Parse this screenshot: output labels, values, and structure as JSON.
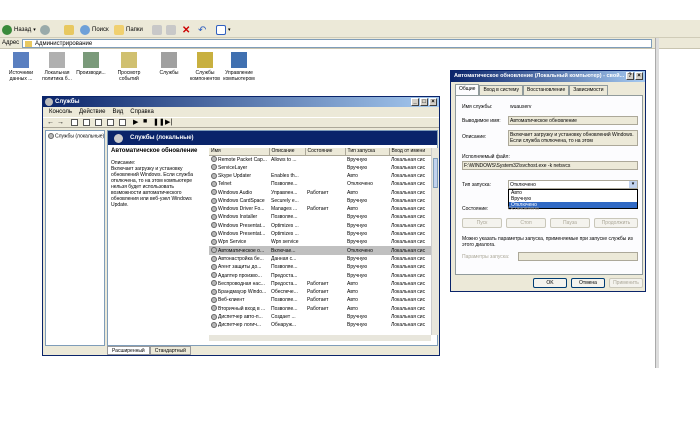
{
  "explorer": {
    "toolbar": {
      "back": "Назад",
      "search": "Поиск",
      "folders": "Папки"
    },
    "address": {
      "label": "Адрес",
      "value": "Администрирование"
    },
    "tools": [
      {
        "label": "Источники данных ...",
        "icon": "database-icon"
      },
      {
        "label": "Локальная политика б...",
        "icon": "security-policy-icon"
      },
      {
        "label": "Производи...",
        "icon": "performance-icon"
      },
      {
        "label": "Просмотр событий",
        "icon": "event-viewer-icon"
      },
      {
        "label": "Службы",
        "icon": "services-icon"
      },
      {
        "label": "Службы компонентов",
        "icon": "component-services-icon"
      },
      {
        "label": "Управление компьютером",
        "icon": "computer-management-icon"
      }
    ]
  },
  "services": {
    "title": "Службы",
    "menu": [
      "Консоль",
      "Действие",
      "Вид",
      "Справка"
    ],
    "tree_item": "Службы (локальные)",
    "pane_header": "Службы (локальные)",
    "desc_title": "Автоматическое обновление",
    "desc_label": "Описание:",
    "desc_text": "Включает загрузку и установку обновлений Windows. Если служба отключена, то на этом компьютере нельзя будет использовать возможности автоматического обновления или веб-узел Windows Update.",
    "columns": [
      "Имя",
      "Описание",
      "Состояние",
      "Тип запуска",
      "Вход от имени"
    ],
    "rows": [
      [
        "Remote Packet Cap...",
        "Allows to ...",
        "",
        "Вручную",
        "Локальная сис"
      ],
      [
        "ServiceLayer",
        "",
        "",
        "Вручную",
        "Локальная сис"
      ],
      [
        "Skype Updater",
        "Enables th...",
        "",
        "Авто",
        "Локальная сис"
      ],
      [
        "Telnet",
        "Позволяе...",
        "",
        "Отключено",
        "Локальная сис"
      ],
      [
        "Windows Audio",
        "Управлен...",
        "Работает",
        "Авто",
        "Локальная сис"
      ],
      [
        "Windows CardSpace",
        "Securely e...",
        "",
        "Вручную",
        "Локальная сис"
      ],
      [
        "Windows Driver Fo...",
        "Manages ...",
        "Работает",
        "Авто",
        "Локальная сис"
      ],
      [
        "Windows Installer",
        "Позволяе...",
        "",
        "Вручную",
        "Локальная сис"
      ],
      [
        "Windows Presentat...",
        "Optimizes ...",
        "",
        "Вручную",
        "Локальная сис"
      ],
      [
        "Windows Presentat...",
        "Optimizes ...",
        "",
        "Вручную",
        "Локальная сис"
      ],
      [
        "Wpn Service",
        "Wpn service",
        "",
        "Вручную",
        "Локальная сис"
      ],
      [
        "Автоматическое о...",
        "Включае...",
        "",
        "Отключено",
        "Локальная сис"
      ],
      [
        "Автонастройка бе...",
        "Данная с...",
        "",
        "Вручную",
        "Локальная сис"
      ],
      [
        "Агент защиты до...",
        "Позволяе...",
        "",
        "Вручную",
        "Локальная сис"
      ],
      [
        "Адаптер произво...",
        "Предоста...",
        "",
        "Вручную",
        "Локальная сис"
      ],
      [
        "Беспроводная нас...",
        "Предоста...",
        "Работает",
        "Авто",
        "Локальная сис"
      ],
      [
        "Брандмауэр Windo...",
        "Обеспече...",
        "Работает",
        "Авто",
        "Локальная сис"
      ],
      [
        "Веб-клиент",
        "Позволяе...",
        "Работает",
        "Авто",
        "Локальная сис"
      ],
      [
        "Вторичный вход в ...",
        "Позволяе...",
        "Работает",
        "Авто",
        "Локальная сис"
      ],
      [
        "Диспетчер авто-п...",
        "Создает ...",
        "",
        "Вручную",
        "Локальная сис"
      ],
      [
        "Диспетчер логич...",
        "Обнаруж...",
        "",
        "Вручную",
        "Локальная сис"
      ]
    ],
    "selected_row": 11,
    "tabs": [
      "Расширенный",
      "Стандартный"
    ]
  },
  "dialog": {
    "title": "Автоматическое обновление (Локальный компьютер) - свой...",
    "tabs": [
      "Общие",
      "Вход в систему",
      "Восстановление",
      "Зависимости"
    ],
    "service_name_label": "Имя службы:",
    "service_name": "wuauserv",
    "display_name_label": "Выводимое имя:",
    "display_name": "Автоматическое обновление",
    "description_label": "Описание:",
    "description": "Включает загрузку и установку обновлений Windows. Если служба отключена, то на этом",
    "exe_label": "Исполняемый файл:",
    "exe_path": "F:\\WINDOWS\\System32\\svchost.exe -k netsvcs",
    "startup_label": "Тип запуска:",
    "startup_value": "Отключено",
    "startup_options": [
      "Авто",
      "Вручную",
      "Отключено"
    ],
    "state_label": "Состояние:",
    "state_value": "Остановлена",
    "buttons": [
      "Пуск",
      "Стоп",
      "Пауза",
      "Продолжить"
    ],
    "hint": "Можно указать параметры запуска, применяемые при запуске службы из этого диалога.",
    "params_label": "Параметры запуска:",
    "ok": "OK",
    "cancel": "Отмена",
    "apply": "Применить"
  }
}
